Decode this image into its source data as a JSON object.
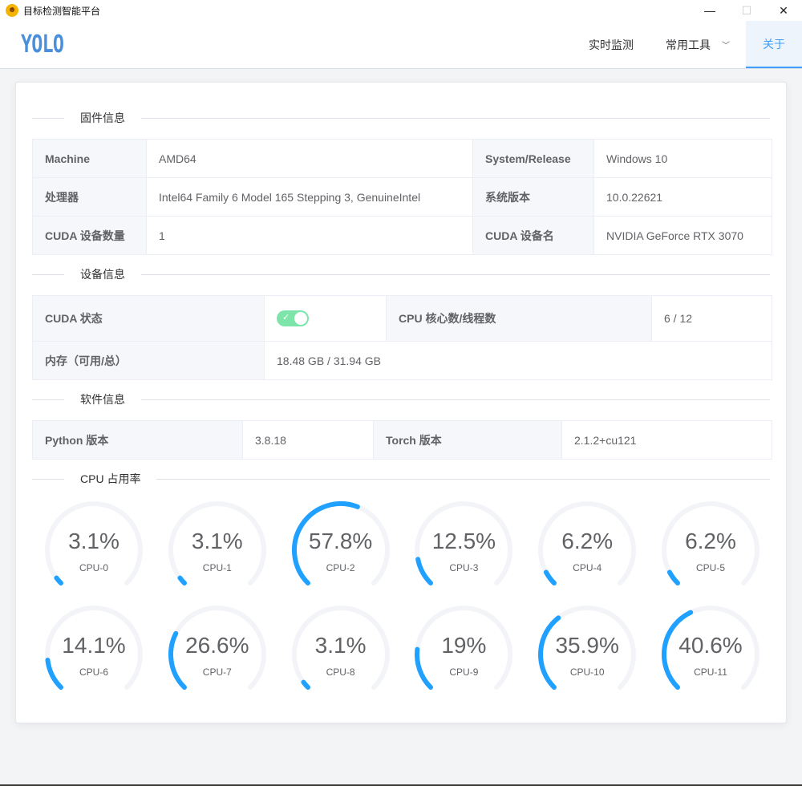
{
  "window": {
    "title": "目标检测智能平台",
    "icon": "smiley-icon"
  },
  "logo": "YOLO",
  "nav": {
    "items": [
      {
        "label": "实时监测"
      },
      {
        "label": "常用工具"
      },
      {
        "label": "关于"
      }
    ],
    "active": "关于"
  },
  "firmware": {
    "title": "固件信息",
    "rows": [
      [
        {
          "label": "Machine",
          "value": "AMD64"
        },
        {
          "label": "System/Release",
          "value": "Windows 10"
        }
      ],
      [
        {
          "label": "处理器",
          "value": "Intel64 Family 6 Model 165 Stepping 3, GenuineIntel"
        },
        {
          "label": "系统版本",
          "value": "10.0.22621"
        }
      ],
      [
        {
          "label": "CUDA 设备数量",
          "value": "1"
        },
        {
          "label": "CUDA 设备名",
          "value": "NVIDIA GeForce RTX 3070"
        }
      ]
    ]
  },
  "device": {
    "title": "设备信息",
    "cuda_label": "CUDA 状态",
    "cuda_enabled": true,
    "cpu_label": "CPU 核心数/线程数",
    "cpu_value": "6 / 12",
    "mem_label": "内存（可用/总）",
    "mem_value": "18.48 GB / 31.94 GB"
  },
  "software": {
    "title": "软件信息",
    "python_label": "Python 版本",
    "python_value": "3.8.18",
    "torch_label": "Torch 版本",
    "torch_value": "2.1.2+cu121"
  },
  "cpu_usage": {
    "title": "CPU 占用率",
    "accent": "#20a0ff",
    "track": "#f3f4f8",
    "gauges": [
      {
        "name": "CPU-0",
        "value": 3.1,
        "text": "3.1%"
      },
      {
        "name": "CPU-1",
        "value": 3.1,
        "text": "3.1%"
      },
      {
        "name": "CPU-2",
        "value": 57.8,
        "text": "57.8%"
      },
      {
        "name": "CPU-3",
        "value": 12.5,
        "text": "12.5%"
      },
      {
        "name": "CPU-4",
        "value": 6.2,
        "text": "6.2%"
      },
      {
        "name": "CPU-5",
        "value": 6.2,
        "text": "6.2%"
      },
      {
        "name": "CPU-6",
        "value": 14.1,
        "text": "14.1%"
      },
      {
        "name": "CPU-7",
        "value": 26.6,
        "text": "26.6%"
      },
      {
        "name": "CPU-8",
        "value": 3.1,
        "text": "3.1%"
      },
      {
        "name": "CPU-9",
        "value": 19,
        "text": "19%"
      },
      {
        "name": "CPU-10",
        "value": 35.9,
        "text": "35.9%"
      },
      {
        "name": "CPU-11",
        "value": 40.6,
        "text": "40.6%"
      }
    ]
  }
}
